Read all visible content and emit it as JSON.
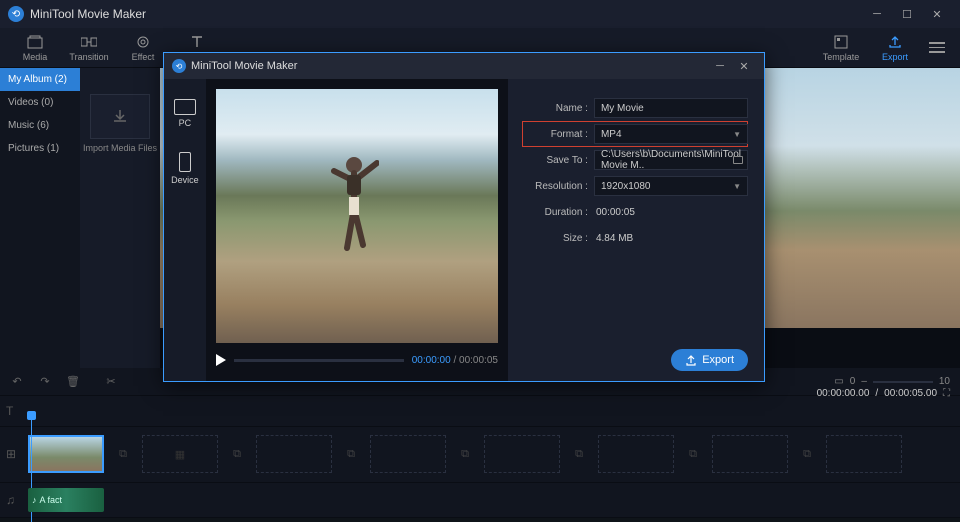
{
  "app": {
    "title": "MiniTool Movie Maker"
  },
  "toolbar": {
    "media": "Media",
    "transition": "Transition",
    "effect": "Effect",
    "text": "Text",
    "template": "Template",
    "export": "Export"
  },
  "sidebar": {
    "items": [
      {
        "label": "My Album (2)",
        "active": true
      },
      {
        "label": "Videos (0)"
      },
      {
        "label": "Music (6)"
      },
      {
        "label": "Pictures (1)"
      }
    ]
  },
  "media": {
    "import_label": "Import Media Files"
  },
  "preview": {
    "time_current": "00:00:00.00",
    "time_total": "00:00:05.00"
  },
  "timeline": {
    "zoom_min": "0",
    "zoom_max": "10",
    "audio_clip": "A fact"
  },
  "dialog": {
    "title": "MiniTool Movie Maker",
    "side": {
      "pc": "PC",
      "device": "Device"
    },
    "preview": {
      "current": "00:00:00",
      "separator": " / ",
      "total": "00:00:05"
    },
    "form": {
      "name_label": "Name :",
      "name_value": "My Movie",
      "format_label": "Format :",
      "format_value": "MP4",
      "saveto_label": "Save To :",
      "saveto_value": "C:\\Users\\b\\Documents\\MiniTool Movie M..",
      "resolution_label": "Resolution :",
      "resolution_value": "1920x1080",
      "duration_label": "Duration :",
      "duration_value": "00:00:05",
      "size_label": "Size :",
      "size_value": "4.84 MB"
    },
    "export_btn": "Export"
  }
}
